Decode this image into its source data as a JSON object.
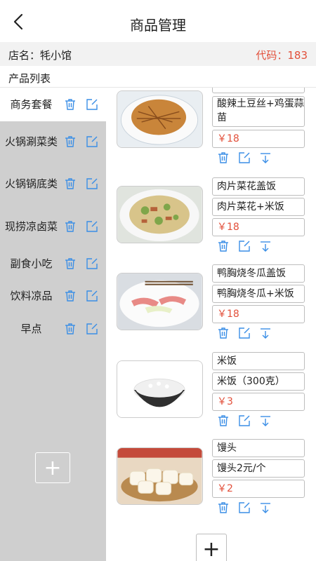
{
  "header": {
    "title": "商品管理"
  },
  "shop": {
    "name_label": "店名：牦小馆",
    "code_label": "代码：183"
  },
  "list_title": "产品列表",
  "categories": [
    {
      "label": "商务套餐",
      "active": true
    },
    {
      "label": "火锅涮菜类",
      "active": false
    },
    {
      "label": "火锅锅底类",
      "active": false
    },
    {
      "label": "现捞凉卤菜",
      "active": false
    },
    {
      "label": "副食小吃",
      "active": false
    },
    {
      "label": "饮料凉品",
      "active": false
    },
    {
      "label": "早点",
      "active": false
    }
  ],
  "add_symbol": "+",
  "products": [
    {
      "image": "shredded-potato",
      "name": "",
      "desc": "酸辣土豆丝+鸡蛋蒜苗",
      "price": "￥18"
    },
    {
      "image": "pork-cauliflower",
      "name": "肉片菜花盖饭",
      "desc": "肉片菜花+米饭",
      "price": "￥18"
    },
    {
      "image": "duck-wintermelon",
      "name": "鸭胸烧冬瓜盖饭",
      "desc": "鸭胸烧冬瓜+米饭",
      "price": "￥18"
    },
    {
      "image": "rice-bowl",
      "name": "米饭",
      "desc": "米饭（300克）",
      "price": "￥3"
    },
    {
      "image": "steamed-buns",
      "name": "馒头",
      "desc": "馒头2元/个",
      "price": "￥2"
    }
  ],
  "colors": {
    "accent": "#3a8ee6",
    "price": "#e2503b",
    "sidebar": "#cfcfcf"
  }
}
